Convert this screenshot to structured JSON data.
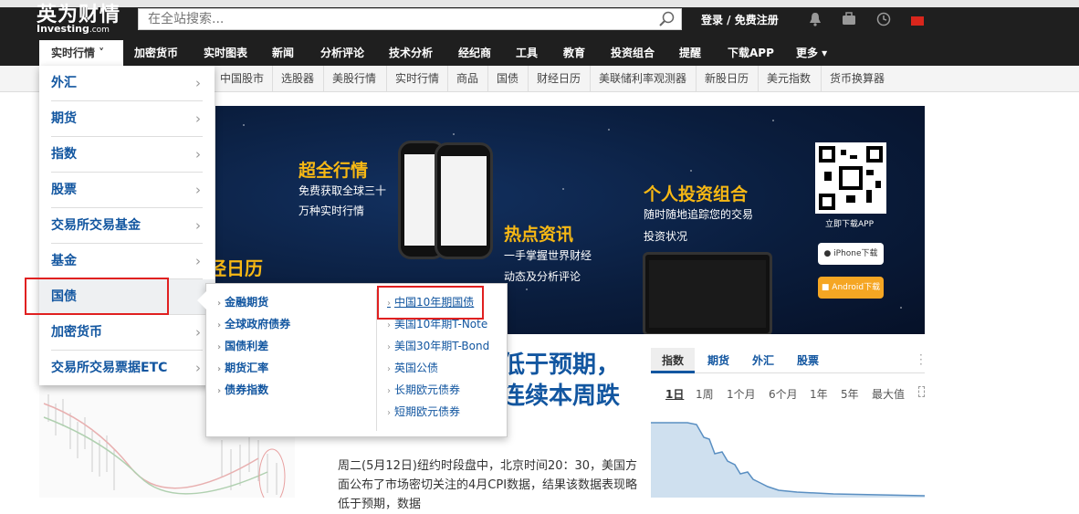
{
  "logo": {
    "cn": "英为财情",
    "en": "Investing",
    "en_suffix": ".com"
  },
  "search": {
    "placeholder": "在全站搜索..."
  },
  "auth": {
    "label": "登录 / 免费注册"
  },
  "nav": [
    {
      "label": "实时行情 ˅"
    },
    {
      "label": "加密货币"
    },
    {
      "label": "实时图表"
    },
    {
      "label": "新闻"
    },
    {
      "label": "分析评论"
    },
    {
      "label": "技术分析"
    },
    {
      "label": "经纪商"
    },
    {
      "label": "工具"
    },
    {
      "label": "教育"
    },
    {
      "label": "投资组合"
    },
    {
      "label": "提醒"
    },
    {
      "label": "下载APP"
    },
    {
      "label": "更多 ▾"
    }
  ],
  "subnav": [
    "中国股市",
    "选股器",
    "美股行情",
    "实时行情",
    "商品",
    "国债",
    "财经日历",
    "美联储利率观测器",
    "新股日历",
    "美元指数",
    "货币换算器"
  ],
  "left_menu": [
    "外汇",
    "期货",
    "指数",
    "股票",
    "交易所交易基金",
    "基金",
    "国债",
    "加密货币",
    "交易所交易票据ETC"
  ],
  "submenu": {
    "col1": [
      "金融期货",
      "全球政府债券",
      "国债利差",
      "期货汇率",
      "债券指数"
    ],
    "col2": [
      "中国10年期国债",
      "美国10年期T-Note",
      "美国30年期T-Bond",
      "英国公债",
      "长期欧元债券",
      "短期欧元债券"
    ]
  },
  "banner": {
    "t1": "超全行情",
    "t1_sub1": "免费获取全球三十",
    "t1_sub2": "万种实时行情",
    "t2": "热点资讯",
    "t2_sub1": "一手掌握世界财经",
    "t2_sub2": "动态及分析评论",
    "t3": "个人投资组合",
    "t3_sub1": "随时随地追踪您的交易",
    "t3_sub2": "投资状况",
    "left_fragment": "经日历",
    "dl_label": "立即下载APP",
    "iphone_btn": "iPhone下载",
    "android_btn": "Android下载"
  },
  "article": {
    "headline1": "低于预期，",
    "headline2": "连续本周跌",
    "para": "周二(5月12日)纽约时段盘中，北京时间20：30，美国方面公布了市场密切关注的4月CPI数据，结果该数据表现略低于预期，数据"
  },
  "widget": {
    "tabs": [
      "指数",
      "期货",
      "外汇",
      "股票"
    ],
    "ranges": [
      "1日",
      "1周",
      "1个月",
      "6个月",
      "1年",
      "5年",
      "最大值"
    ]
  },
  "colors": {
    "brand_blue": "#1256a0",
    "dark": "#1f1f1f",
    "highlight_red": "#e02020",
    "banner_yellow": "#f7b814"
  }
}
